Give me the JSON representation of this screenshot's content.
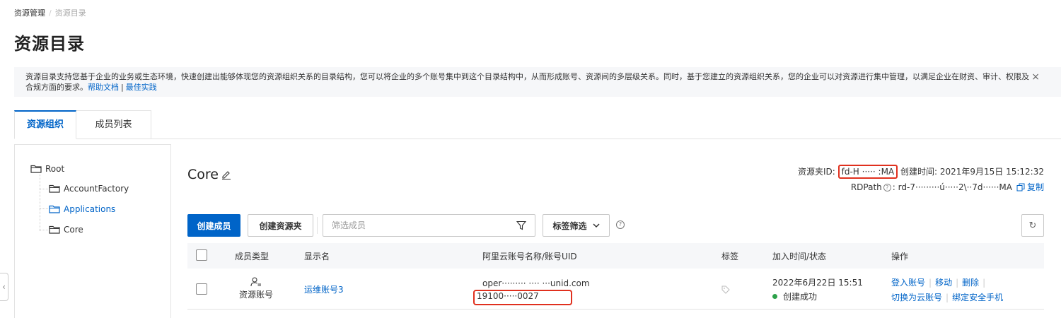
{
  "breadcrumb": {
    "parent": "资源管理",
    "current": "资源目录"
  },
  "page_title": "资源目录",
  "notice": {
    "text": "资源目录支持您基于企业的业务或生态环境，快速创建出能够体现您的资源组织关系的目录结构，您可以将企业的多个账号集中到这个目录结构中，从而形成账号、资源间的多层级关系。同时，基于您建立的资源组织关系，您的企业可以对资源进行集中管理，以满足企业在财资、审计、权限及合规方面的要求。",
    "help_link": "帮助文档",
    "separator": "|",
    "best_practice_link": "最佳实践",
    "close_glyph": "×"
  },
  "tabs": [
    {
      "label": "资源组织",
      "active": true
    },
    {
      "label": "成员列表",
      "active": false
    }
  ],
  "tree": [
    {
      "label": "Root",
      "icon": "folder-icon",
      "selected": false
    },
    {
      "label": "AccountFactory",
      "icon": "folder-icon",
      "selected": false
    },
    {
      "label": "Applications",
      "icon": "folder-icon",
      "selected": true
    },
    {
      "label": "Core",
      "icon": "folder-icon",
      "selected": false
    }
  ],
  "expand_handle_glyph": "‹",
  "folder": {
    "name": "Core",
    "id_label": "资源夹ID:",
    "id_value": "fd-H ····· :MA",
    "created_label": "创建时间:",
    "created_value": "2021年9月15日 15:12:32",
    "rdpath_label": "RDPath",
    "rdpath_help": "?",
    "rdpath_value": ": rd-7·········ú·····2\\··7d······MA",
    "copy_label": "复制"
  },
  "toolbar": {
    "create_member": "创建成员",
    "create_folder": "创建资源夹",
    "filter_placeholder": "筛选成员",
    "tag_filter": "标签筛选",
    "help_glyph": "?",
    "refresh_glyph": "↻"
  },
  "table": {
    "headers": [
      "成员类型",
      "显示名",
      "阿里云账号名称/账号UID",
      "标签",
      "加入时间/状态",
      "操作"
    ],
    "rows": [
      {
        "member_type": "资源账号",
        "display_name": "运维账号3",
        "account_name": "oper········· ···· ···unid.com",
        "uid": "19100·····0027",
        "join_time": "2022年6月22日 15:51",
        "status": "创建成功",
        "status_color": "#2ca14a",
        "actions_line1": [
          "登入账号",
          "移动",
          "删除"
        ],
        "actions_line2": [
          "切换为云账号",
          "绑定安全手机"
        ]
      }
    ]
  },
  "colors": {
    "primary": "#0064c8",
    "highlight": "#e0301e",
    "success": "#2ca14a"
  }
}
